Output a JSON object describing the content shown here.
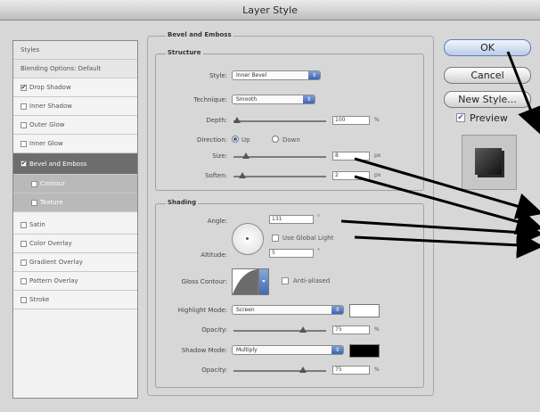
{
  "window": {
    "title": "Layer Style"
  },
  "sidebar": {
    "items": [
      {
        "label": "Styles",
        "type": "header"
      },
      {
        "label": "Blending Options: Default",
        "type": "header"
      },
      {
        "label": "Drop Shadow",
        "checked": true
      },
      {
        "label": "Inner Shadow",
        "checked": false
      },
      {
        "label": "Outer Glow",
        "checked": false
      },
      {
        "label": "Inner Glow",
        "checked": false
      },
      {
        "label": "Bevel and Emboss",
        "checked": true,
        "selected": true
      },
      {
        "label": "Contour",
        "checked": false,
        "sub": true
      },
      {
        "label": "Texture",
        "checked": false,
        "sub": true
      },
      {
        "label": "Satin",
        "checked": false
      },
      {
        "label": "Color Overlay",
        "checked": false
      },
      {
        "label": "Gradient Overlay",
        "checked": false
      },
      {
        "label": "Pattern Overlay",
        "checked": false
      },
      {
        "label": "Stroke",
        "checked": false
      }
    ]
  },
  "bevel": {
    "title": "Bevel and Emboss",
    "structure": {
      "title": "Structure",
      "style_label": "Style:",
      "style_value": "Inner Bevel",
      "technique_label": "Technique:",
      "technique_value": "Smooth",
      "depth_label": "Depth:",
      "depth_value": "100",
      "depth_unit": "%",
      "direction_label": "Direction:",
      "direction_up": "Up",
      "direction_down": "Down",
      "direction_selected": "Up",
      "size_label": "Size:",
      "size_value": "8",
      "size_unit": "px",
      "soften_label": "Soften:",
      "soften_value": "2",
      "soften_unit": "px"
    },
    "shading": {
      "title": "Shading",
      "angle_label": "Angle:",
      "angle_value": "131",
      "degree_symbol": "°",
      "use_global_light": "Use Global Light",
      "altitude_label": "Altitude:",
      "altitude_value": "5",
      "gloss_contour_label": "Gloss Contour:",
      "anti_aliased": "Anti-aliased",
      "highlight_mode_label": "Highlight Mode:",
      "highlight_mode_value": "Screen",
      "highlight_color": "#ffffff",
      "highlight_opacity_label": "Opacity:",
      "highlight_opacity_value": "75",
      "shadow_mode_label": "Shadow Mode:",
      "shadow_mode_value": "Multiply",
      "shadow_color": "#000000",
      "shadow_opacity_label": "Opacity:",
      "shadow_opacity_value": "75",
      "percent": "%"
    }
  },
  "buttons": {
    "ok": "OK",
    "cancel": "Cancel",
    "new_style": "New Style...",
    "preview_label": "Preview"
  }
}
